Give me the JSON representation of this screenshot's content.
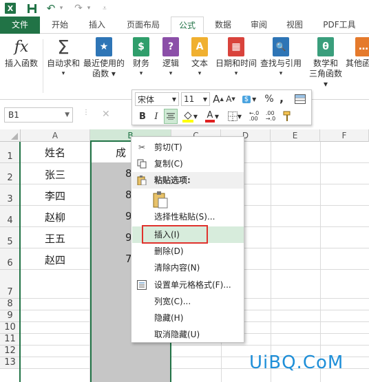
{
  "titlebar": {
    "app_icon_letter": "X",
    "icons": [
      "excel-logo-icon",
      "save-icon",
      "undo-icon",
      "undo-dropdown-icon",
      "redo-icon",
      "redo-dropdown-icon",
      "customize-qa-icon"
    ]
  },
  "tabs": [
    {
      "label": "文件"
    },
    {
      "label": "开始"
    },
    {
      "label": "插入"
    },
    {
      "label": "页面布局"
    },
    {
      "label": "公式"
    },
    {
      "label": "数据"
    },
    {
      "label": "审阅"
    },
    {
      "label": "视图"
    },
    {
      "label": "PDF工具"
    }
  ],
  "active_tab": "公式",
  "ribbon": {
    "insert_function": {
      "glyph": "fx",
      "label": "插入函数"
    },
    "autosum": {
      "glyph": "Σ",
      "label1": "自动求和",
      "arrow": "▾"
    },
    "recent": {
      "glyph": "★",
      "label1": "最近使用的",
      "label2": "函数 ▾"
    },
    "financial": {
      "glyph": "$",
      "label1": "财务",
      "label2": "▾"
    },
    "logical": {
      "glyph": "?",
      "label1": "逻辑",
      "label2": "▾"
    },
    "text": {
      "glyph": "A",
      "label1": "文本",
      "label2": "▾"
    },
    "datetime": {
      "glyph": "▦",
      "label1": "日期和时间",
      "label2": "▾"
    },
    "lookup": {
      "glyph": "🔍",
      "label1": "查找与引用",
      "label2": "▾"
    },
    "math": {
      "glyph": "θ",
      "label1": "数学和",
      "label2": "三角函数 ▾"
    },
    "more": {
      "glyph": "…",
      "label1": "其他函"
    }
  },
  "formula_bar": {
    "name_box": "B1",
    "cancel": "✕"
  },
  "mini_toolbar": {
    "font_name": "宋体",
    "font_size": "11",
    "grow": "A",
    "shrink": "A",
    "currency": "$",
    "percent": "%",
    "comma": ",",
    "bold": "B",
    "italic": "I",
    "font_color_letter": "A",
    "dec_inc": "←.0\n.00",
    "dec_dec": ".00\n→.0"
  },
  "columns": [
    "A",
    "B",
    "C",
    "D",
    "E",
    "F"
  ],
  "rows": [
    "1",
    "2",
    "3",
    "4",
    "5",
    "6",
    "7",
    "8",
    "9",
    "10",
    "11",
    "12",
    "13"
  ],
  "cells": {
    "A": [
      "姓名",
      "张三",
      "李四",
      "赵柳",
      "王五",
      "赵四"
    ],
    "B": [
      "成",
      "8",
      "8",
      "9",
      "9",
      "7"
    ]
  },
  "context_menu": {
    "cut": "剪切(T)",
    "copy": "复制(C)",
    "paste_options": "粘贴选项:",
    "paste_special": "选择性粘贴(S)...",
    "insert": "插入(I)",
    "delete": "删除(D)",
    "clear": "清除内容(N)",
    "format_cells": "设置单元格格式(F)...",
    "column_width": "列宽(C)...",
    "hide": "隐藏(H)",
    "unhide": "取消隐藏(U)"
  },
  "watermark": "UiBQ.CoM",
  "colors": {
    "excel_green": "#217346",
    "highlight_red": "#e0312c",
    "selection_gray": "#c6c6c6"
  }
}
